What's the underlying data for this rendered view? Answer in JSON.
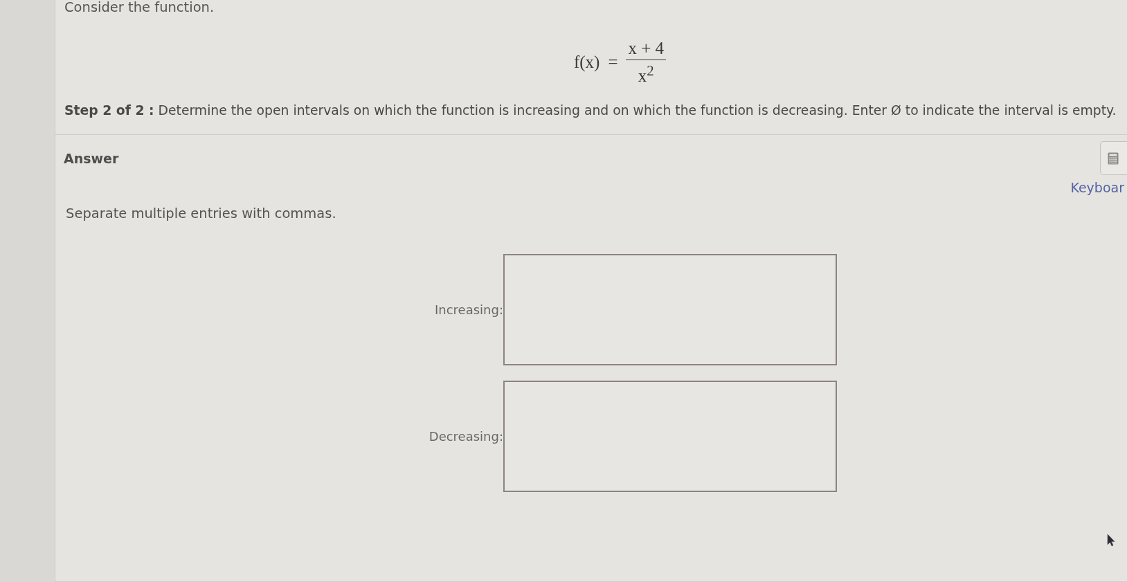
{
  "intro": "Consider the function.",
  "formula": {
    "lhs": "f(x)",
    "equals": "=",
    "numerator": "x + 4",
    "denominator": "x$^{2}$"
  },
  "step": "**Step 2 of 2 :** Determine the open intervals on which the function is increasing and on which the function is decreasing. Enter Ø to indicate the interval is empty.",
  "answer": {
    "heading": "Answer",
    "keyboard_label": "Keyboar",
    "instruction": "Separate multiple entries with commas.",
    "fields": [
      {
        "label": "Increasing:"
      },
      {
        "label": "Decreasing:"
      }
    ]
  }
}
